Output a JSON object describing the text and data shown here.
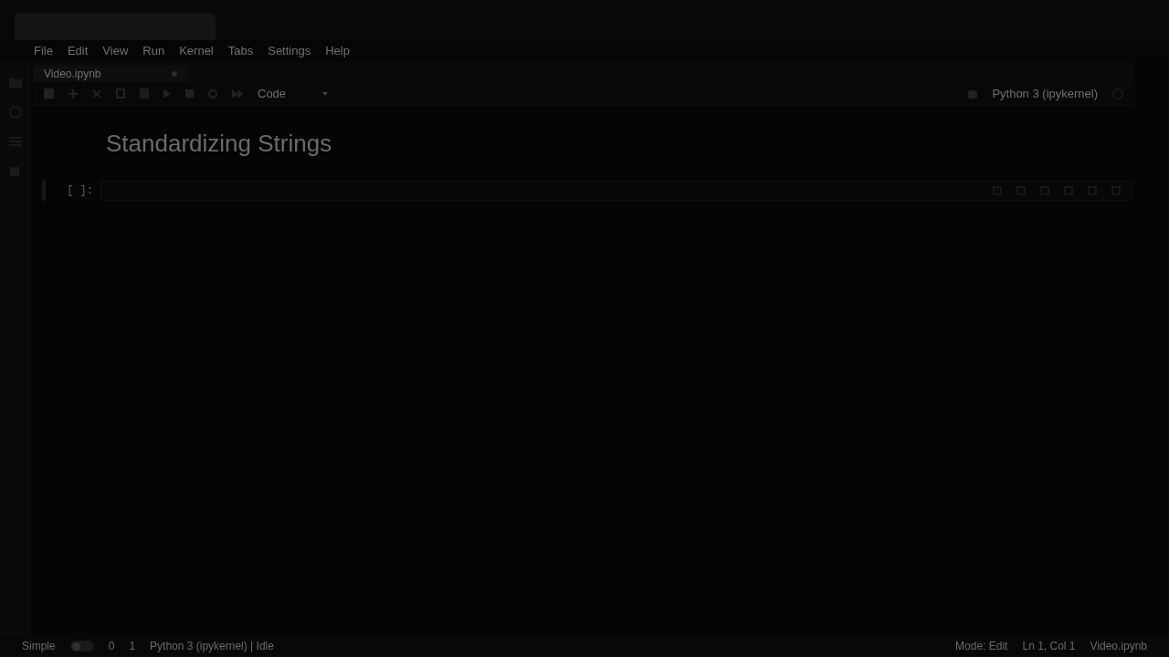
{
  "menu": [
    "File",
    "Edit",
    "View",
    "Run",
    "Kernel",
    "Tabs",
    "Settings",
    "Help"
  ],
  "tabs": [
    {
      "label": "Video.ipynb",
      "selected": true
    }
  ],
  "toolbar": {
    "cell_type": "Code",
    "kernel": "Python 3 (ipykernel)"
  },
  "notebook": {
    "heading": "Standardizing Strings",
    "cells": [
      {
        "prompt": "[ ]:",
        "selected": true
      }
    ]
  },
  "status_bar": {
    "mode_label": "Simple",
    "simple_on": false,
    "left_items": [
      "0",
      "1"
    ],
    "kernel_status": "Python 3 (ipykernel) | Idle",
    "right_items": [
      "Mode: Edit",
      "Ln 1, Col 1",
      "Video.ipynb"
    ]
  }
}
